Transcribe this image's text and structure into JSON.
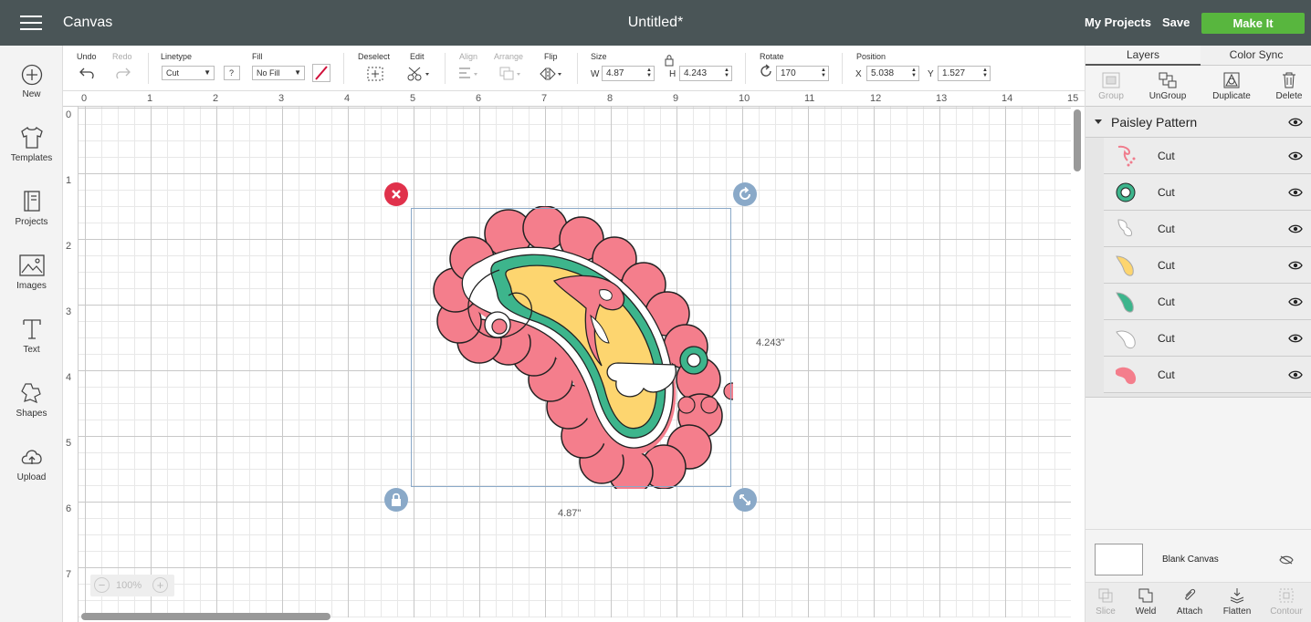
{
  "header": {
    "app_title": "Canvas",
    "doc_title": "Untitled*",
    "my_projects": "My Projects",
    "save": "Save",
    "make_it": "Make It"
  },
  "left_nav": [
    {
      "label": "New",
      "icon": "plus-circle-icon"
    },
    {
      "label": "Templates",
      "icon": "shirt-icon"
    },
    {
      "label": "Projects",
      "icon": "book-icon"
    },
    {
      "label": "Images",
      "icon": "image-icon"
    },
    {
      "label": "Text",
      "icon": "text-icon"
    },
    {
      "label": "Shapes",
      "icon": "shapes-icon"
    },
    {
      "label": "Upload",
      "icon": "upload-icon"
    }
  ],
  "toolbar": {
    "undo": "Undo",
    "redo": "Redo",
    "linetype_label": "Linetype",
    "linetype_value": "Cut",
    "help": "?",
    "fill_label": "Fill",
    "fill_value": "No Fill",
    "deselect": "Deselect",
    "edit": "Edit",
    "align": "Align",
    "arrange": "Arrange",
    "flip": "Flip",
    "size_label": "Size",
    "w_label": "W",
    "w_value": "4.87",
    "h_label": "H",
    "h_value": "4.243",
    "rotate_label": "Rotate",
    "rotate_value": "170",
    "position_label": "Position",
    "x_label": "X",
    "x_value": "5.038",
    "y_label": "Y",
    "y_value": "1.527",
    "cut_color": "#d0103a"
  },
  "canvas": {
    "ruler_top": [
      "0",
      "1",
      "2",
      "3",
      "4",
      "5",
      "6",
      "7",
      "8",
      "9",
      "10",
      "11",
      "12",
      "13",
      "14",
      "15"
    ],
    "ruler_left": [
      "0",
      "1",
      "2",
      "3",
      "4",
      "5",
      "6",
      "7"
    ],
    "width_label": "4.87\"",
    "height_label": "4.243\"",
    "zoom": "100%",
    "zoom_out": "−",
    "zoom_in": "+"
  },
  "right_panel": {
    "tabs": [
      "Layers",
      "Color Sync"
    ],
    "tools": [
      {
        "label": "Group",
        "enabled": false
      },
      {
        "label": "UnGroup",
        "enabled": true
      },
      {
        "label": "Duplicate",
        "enabled": true
      },
      {
        "label": "Delete",
        "enabled": true
      }
    ],
    "group_name": "Paisley Pattern",
    "layers": [
      {
        "label": "Cut",
        "color": "#f07c8c"
      },
      {
        "label": "Cut",
        "color": "#3db58c"
      },
      {
        "label": "Cut",
        "color": "#ffffff"
      },
      {
        "label": "Cut",
        "color": "#fdd56f"
      },
      {
        "label": "Cut",
        "color": "#3db58c"
      },
      {
        "label": "Cut",
        "color": "#ffffff"
      },
      {
        "label": "Cut",
        "color": "#f47e8c"
      }
    ],
    "blank_canvas": "Blank Canvas",
    "bottom_tools": [
      {
        "label": "Slice",
        "enabled": false
      },
      {
        "label": "Weld",
        "enabled": true
      },
      {
        "label": "Attach",
        "enabled": true
      },
      {
        "label": "Flatten",
        "enabled": true
      },
      {
        "label": "Contour",
        "enabled": false
      }
    ]
  },
  "colors": {
    "header_bg": "#4a5557",
    "make_it_green": "#58b63e",
    "pink": "#f47e8c",
    "yellow": "#fdd56f",
    "teal": "#3db58c"
  }
}
